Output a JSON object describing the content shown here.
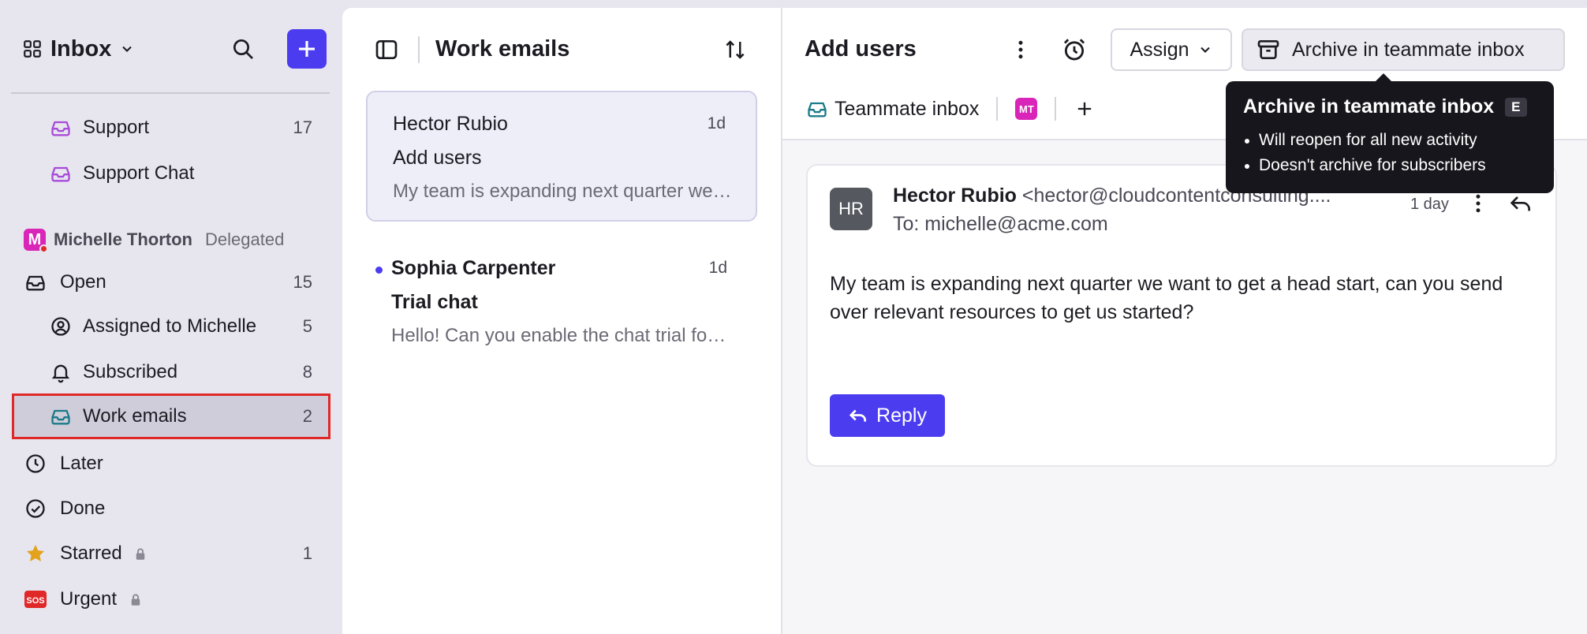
{
  "sidebar": {
    "title": "Inbox",
    "items_top": [
      {
        "label": "Support",
        "count": "17"
      },
      {
        "label": "Support Chat",
        "count": ""
      }
    ],
    "section": {
      "avatar_letter": "M",
      "name": "Michelle Thorton",
      "status": "Delegated"
    },
    "items": [
      {
        "label": "Open",
        "count": "15"
      },
      {
        "label": "Assigned to Michelle",
        "count": "5"
      },
      {
        "label": "Subscribed",
        "count": "8"
      },
      {
        "label": "Work emails",
        "count": "2"
      },
      {
        "label": "Later",
        "count": ""
      },
      {
        "label": "Done",
        "count": ""
      },
      {
        "label": "Starred",
        "count": "1"
      },
      {
        "label": "Urgent",
        "count": ""
      }
    ]
  },
  "list": {
    "title": "Work emails",
    "conversations": [
      {
        "from": "Hector Rubio",
        "age": "1d",
        "subject": "Add users",
        "preview": "My team is expanding next quarter we want to get a head start, can you send over relevant resources"
      },
      {
        "from": "Sophia Carpenter",
        "age": "1d",
        "subject": "Trial chat",
        "preview": "Hello! Can you enable the chat trial for our workspace"
      }
    ]
  },
  "detail": {
    "title": "Add users",
    "assign_label": "Assign",
    "archive_label": "Archive in teammate inbox",
    "inbox_tag": "Teammate inbox",
    "teammate_badge": "MT",
    "message": {
      "avatar": "HR",
      "from_name": "Hector Rubio",
      "from_addr": "<hector@cloudcontentconsulting....",
      "to": "To: michelle@acme.com",
      "age": "1 day",
      "body": "My team is expanding next quarter we want to get a head start, can you send over relevant resources to get us started?",
      "reply_label": "Reply"
    }
  },
  "tooltip": {
    "title": "Archive in teammate inbox",
    "shortcut": "E",
    "lines": [
      "Will reopen for all new activity",
      "Doesn't archive for subscribers"
    ]
  },
  "colors": {
    "accent": "#4b3cf0",
    "selected_outline": "#e02828",
    "teammate": "#d925b8",
    "star": "#e2a21b",
    "urgent": "#e02828"
  }
}
